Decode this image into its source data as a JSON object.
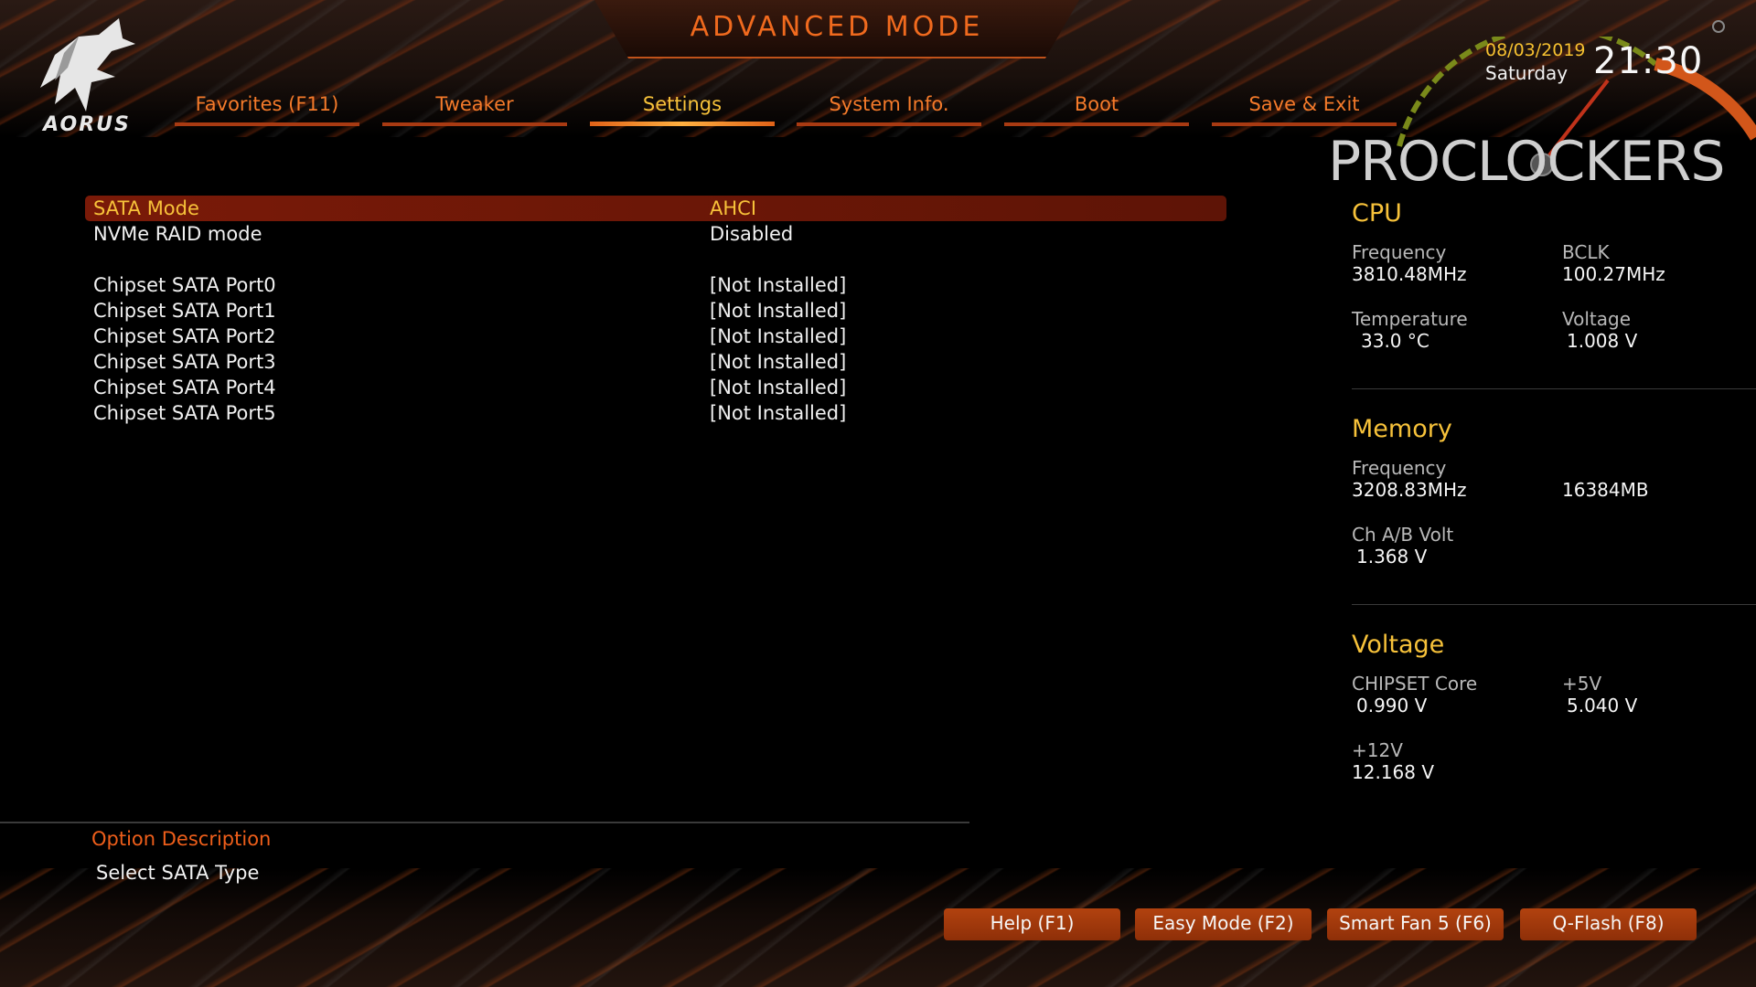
{
  "header": {
    "title": "ADVANCED MODE",
    "logo_text": "AORUS",
    "watermark": "PROCLOCKERS"
  },
  "tabs": [
    {
      "label": "Favorites (F11)",
      "active": false
    },
    {
      "label": "Tweaker",
      "active": false
    },
    {
      "label": "Settings",
      "active": true
    },
    {
      "label": "System Info.",
      "active": false
    },
    {
      "label": "Boot",
      "active": false
    },
    {
      "label": "Save & Exit",
      "active": false
    }
  ],
  "clock": {
    "date": "08/03/2019",
    "day": "Saturday",
    "time": "21:30"
  },
  "settings": [
    {
      "label": "SATA Mode",
      "value": "AHCI",
      "selected": true
    },
    {
      "label": "NVMe RAID mode",
      "value": "Disabled",
      "selected": false
    },
    {
      "label": "Chipset SATA Port0",
      "value": "[Not Installed]",
      "selected": false
    },
    {
      "label": "Chipset SATA Port1",
      "value": "[Not Installed]",
      "selected": false
    },
    {
      "label": "Chipset SATA Port2",
      "value": "[Not Installed]",
      "selected": false
    },
    {
      "label": "Chipset SATA Port3",
      "value": "[Not Installed]",
      "selected": false
    },
    {
      "label": "Chipset SATA Port4",
      "value": "[Not Installed]",
      "selected": false
    },
    {
      "label": "Chipset SATA Port5",
      "value": "[Not Installed]",
      "selected": false
    }
  ],
  "description": {
    "title": "Option Description",
    "text": "Select SATA Type"
  },
  "system": {
    "cpu": {
      "title": "CPU",
      "frequency_label": "Frequency",
      "frequency": "3810.48MHz",
      "bclk_label": "BCLK",
      "bclk": "100.27MHz",
      "temperature_label": "Temperature",
      "temperature": "33.0 °C",
      "voltage_label": "Voltage",
      "voltage": "1.008 V"
    },
    "memory": {
      "title": "Memory",
      "frequency_label": "Frequency",
      "frequency": "3208.83MHz",
      "size": "16384MB",
      "chab_volt_label": "Ch A/B Volt",
      "chab_volt": "1.368 V"
    },
    "voltage": {
      "title": "Voltage",
      "chipset_core_label": "CHIPSET Core",
      "chipset_core": "0.990 V",
      "plus5v_label": "+5V",
      "plus5v": "5.040 V",
      "plus12v_label": "+12V",
      "plus12v": "12.168 V"
    }
  },
  "footer": {
    "help": "Help (F1)",
    "easy_mode": "Easy Mode (F2)",
    "smart_fan": "Smart Fan 5 (F6)",
    "qflash": "Q-Flash (F8)"
  },
  "colors": {
    "accent_orange": "#f06a1e",
    "highlight_yellow": "#f7c23a",
    "selected_row": "#7a1a08",
    "button": "#a03a0c"
  }
}
